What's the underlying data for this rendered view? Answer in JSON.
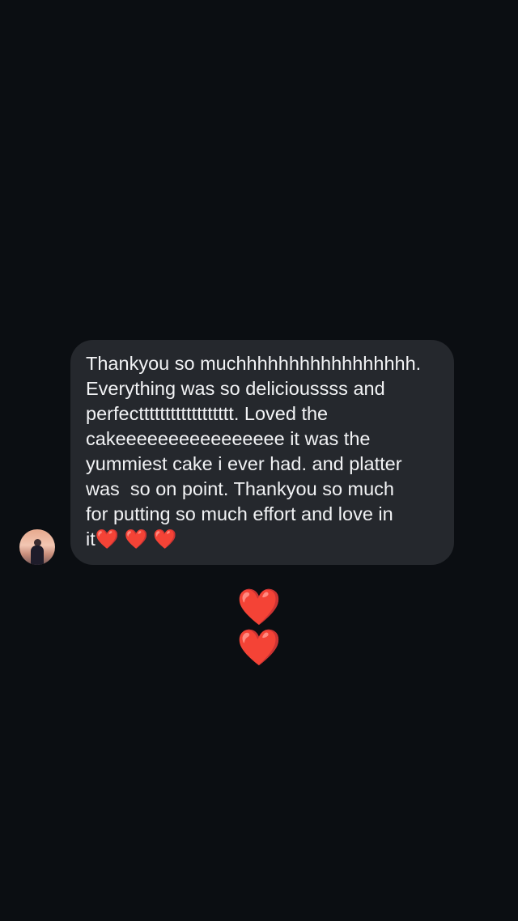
{
  "conversation": {
    "incoming_message": {
      "text": "Thankyou so muchhhhhhhhhhhhhhhhh.\nEverything was so delicioussss and\nperfectttttttttttttttttt. Loved the\ncakeeeeeeeeeeeeeeee it was the\nyummiest cake i ever had. and platter\nwas  so on point. Thankyou so much\nfor putting so much effort and love in\nit❤️ ❤️ ❤️"
    },
    "reply_message": {
      "text": "❤️❤️"
    }
  },
  "colors": {
    "background": "#0b0e12",
    "bubble": "#25282d",
    "heart": "#e5162c"
  }
}
